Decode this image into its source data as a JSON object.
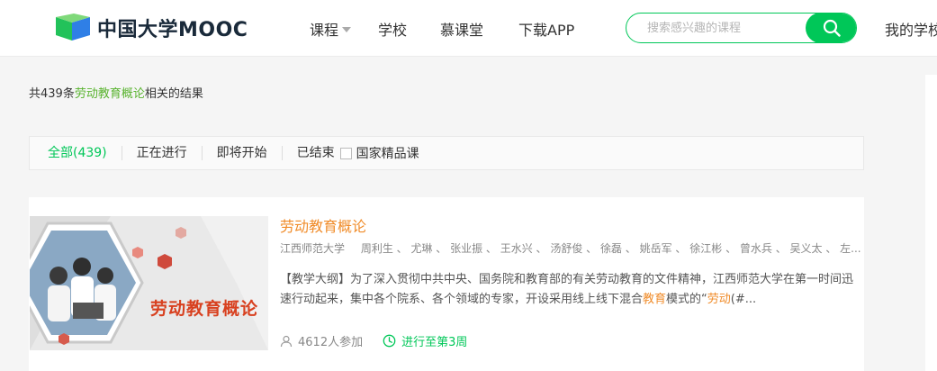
{
  "header": {
    "logo_text": "中国大学MOOC",
    "nav": [
      {
        "label": "课程",
        "has_dropdown": true
      },
      {
        "label": "学校"
      },
      {
        "label": "慕课堂"
      },
      {
        "label": "下载APP"
      }
    ],
    "search": {
      "placeholder": "搜索感兴趣的课程",
      "value": ""
    },
    "my_school": "我的学校"
  },
  "summary": {
    "prefix": "共439条",
    "keyword": "劳动教育概论",
    "suffix": "相关的结果"
  },
  "filters": {
    "items": [
      "全部(439)",
      "正在进行",
      "即将开始",
      "已结束"
    ],
    "active_index": 0,
    "checkbox_label": "国家精品课",
    "checkbox_checked": false
  },
  "course": {
    "thumbnail_title": "劳动教育概论",
    "title": "劳动教育概论",
    "school": "江西师范大学",
    "teachers": "周利生 、 尤琳 、 张业振 、 王水兴 、 汤舒俊 、 徐磊 、 姚岳军 、 徐江彬 、 曾水兵 、 吴义太 、 左...",
    "desc_part1": "【教学大纲】为了深入贯彻中共中央、国务院和教育部的有关劳动教育的文件精神，江西师范大学在第一时间迅速行动起来，集中各个院系、各个领域的专家，开设采用线上线下混合",
    "desc_hl1": "教育",
    "desc_part2": "模式的“",
    "desc_hl2": "劳动",
    "desc_part3": "(#...",
    "participants": "4612人参加",
    "progress": "进行至第3周"
  },
  "colors": {
    "brand_green": "#00c758",
    "keyword_green": "#59b32f",
    "title_orange": "#f08c2a"
  },
  "icons": [
    "logo-icon",
    "search-icon",
    "user-icon",
    "clock-icon"
  ]
}
